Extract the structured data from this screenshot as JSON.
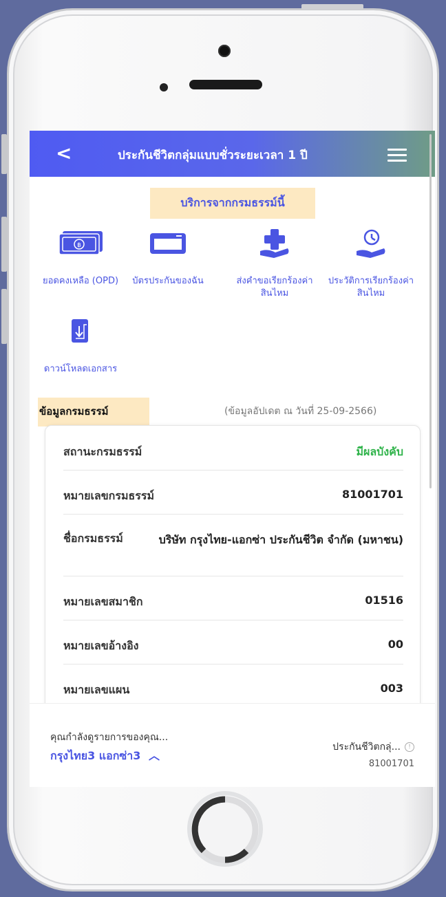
{
  "header": {
    "back_icon": "chevron-left-icon",
    "title": "ประกันชีวิตกลุ่มแบบชั่วระยะเวลา 1 ปี",
    "menu_icon": "hamburger-menu-icon"
  },
  "services": {
    "title": "บริการจากกรมธรรม์นี้",
    "items": [
      {
        "icon": "money-icon",
        "label": "ยอดคงเหลือ (OPD)"
      },
      {
        "icon": "card-icon",
        "label": "บัตรประกันของฉัน"
      },
      {
        "icon": "medical-claim-icon",
        "label": "ส่งคำขอเรียกร้องค่าสินไหม"
      },
      {
        "icon": "claim-history-icon",
        "label": "ประวัติการเรียกร้องค่าสินไหม"
      },
      {
        "icon": "download-document-icon",
        "label": "ดาวน์โหลดเอกสาร"
      }
    ]
  },
  "policy_info": {
    "title": "ข้อมูลกรมธรรม์",
    "updated": "(ข้อมูลอัปเดต ณ วันที่ 25-09-2566)",
    "rows": [
      {
        "label": "สถานะกรมธรรม์",
        "value": "มีผลบังคับ"
      },
      {
        "label": "หมายเลขกรมธรรม์",
        "value": "81001701"
      },
      {
        "label": "ชื่อกรมธรรม์",
        "value": "บริษัท กรุงไทย-แอกซ่า ประกันชีวิต จำกัด (มหาชน)"
      },
      {
        "label": "หมายเลขสมาชิก",
        "value": "01516"
      },
      {
        "label": "หมายเลขอ้างอิง",
        "value": "00"
      },
      {
        "label": "หมายเลขแผน",
        "value": "003"
      }
    ]
  },
  "footer": {
    "hint": "คุณกำลังดูรายการของคุณ...",
    "account": "กรุงไทย3 แอกซ่า3",
    "product": "ประกันชีวิตกลุ่...",
    "policy_no": "81001701"
  },
  "colors": {
    "accent": "#4a55e2",
    "highlight": "#fde9c2",
    "status_green": "#2fb34a"
  }
}
